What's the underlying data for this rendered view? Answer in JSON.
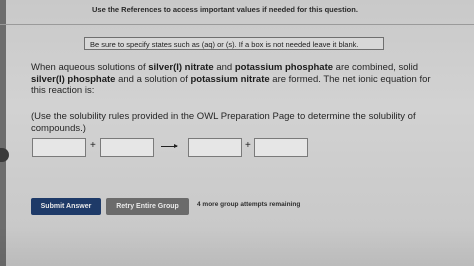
{
  "header": {
    "references_text": "Use the References to access important values if needed for this question."
  },
  "notice": {
    "text": "Be sure to specify states such as (aq) or (s).  If a box is not needed leave it blank."
  },
  "question": {
    "part1": "When aqueous solutions of ",
    "reactant1": "silver(I) nitrate",
    "part2": " and ",
    "reactant2": "potassium phosphate",
    "part3": " are combined, solid ",
    "product1": "silver(I) phosphate",
    "part4": " and a solution of ",
    "product2": "potassium nitrate",
    "part5": " are formed. The net ionic equation for this reaction is:"
  },
  "hint": {
    "text": "(Use the solubility rules provided in the OWL Preparation Page to determine the solubility of compounds.)"
  },
  "equation": {
    "plus1": "+",
    "plus2": "+",
    "boxes": [
      "",
      "",
      "",
      ""
    ]
  },
  "actions": {
    "submit_label": "Submit Answer",
    "retry_label": "Retry Entire Group",
    "attempts_text": "4 more group attempts remaining"
  },
  "colors": {
    "submit_bg": "#1e3a68",
    "retry_bg": "#6b6b6b"
  }
}
